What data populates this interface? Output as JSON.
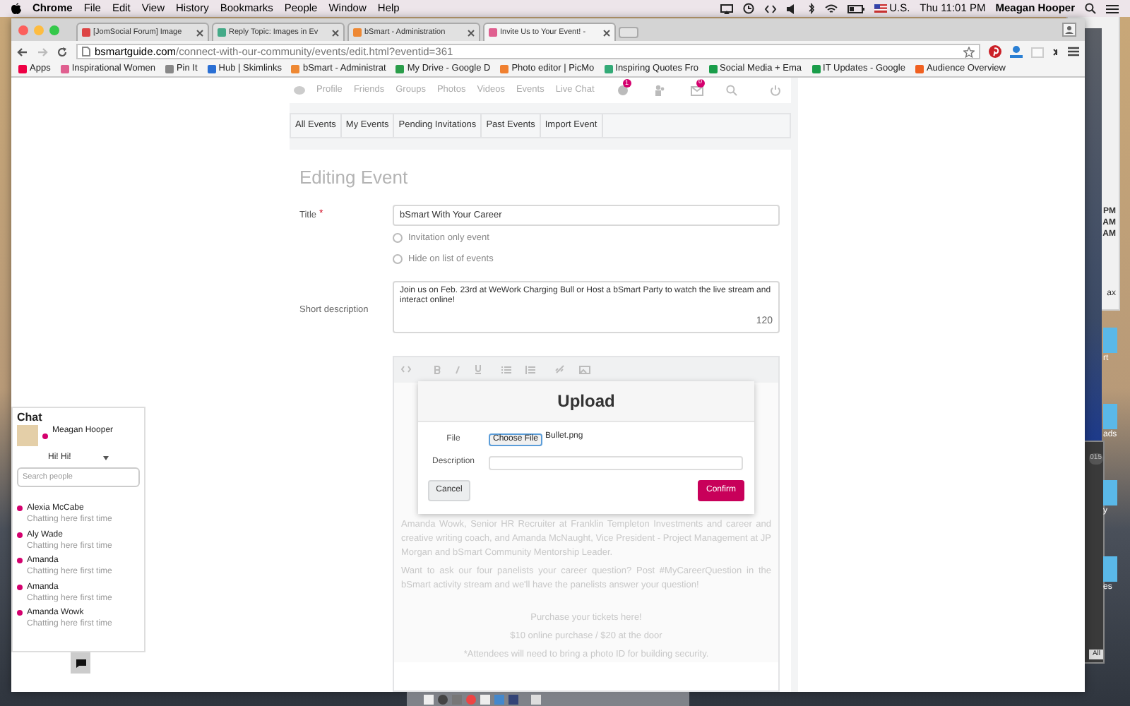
{
  "menu_bar": {
    "app": "Chrome",
    "menus": [
      "File",
      "Edit",
      "View",
      "History",
      "Bookmarks",
      "People",
      "Window",
      "Help"
    ],
    "input_source": "U.S.",
    "clock": "Thu 11:01 PM",
    "user": "Meagan Hooper"
  },
  "browser": {
    "tabs": [
      {
        "title": "[JomSocial Forum] Image",
        "selected": false
      },
      {
        "title": "Reply Topic: Images in Ev",
        "selected": false
      },
      {
        "title": "bSmart - Administration",
        "selected": false
      },
      {
        "title": "Invite Us to Your Event! -",
        "selected": true
      }
    ],
    "url_domain": "bsmartguide.com",
    "url_path": "/connect-with-our-community/events/edit.html?eventid=361",
    "bookmarks": [
      "Apps",
      "Inspirational Women",
      "Pin It",
      "Hub | Skimlinks",
      "bSmart - Administrat",
      "My Drive - Google D",
      "Photo editor | PicMo",
      "Inspiring Quotes Fro",
      "Social Media + Ema",
      "IT Updates - Google",
      "Audience Overview"
    ]
  },
  "site_nav": {
    "links": [
      "Profile",
      "Friends",
      "Groups",
      "Photos",
      "Videos",
      "Events",
      "Live Chat"
    ],
    "notification_badge": "1",
    "message_badge": "0"
  },
  "event_tabs": [
    "All Events",
    "My Events",
    "Pending Invitations",
    "Past Events",
    "Import Event"
  ],
  "form": {
    "heading": "Editing Event",
    "title_label": "Title",
    "required_mark": "*",
    "title_value": "bSmart With Your Career",
    "options": [
      {
        "label": "Invitation only event",
        "checked": false
      },
      {
        "label": "Hide on list of events",
        "checked": false
      }
    ],
    "description_label": "Short description",
    "description_value": "Join us on Feb. 23rd at WeWork Charging Bull or Host a bSmart Party to watch the live stream and interact online!",
    "char_count": "120"
  },
  "editor": {
    "paragraphs": [
      {
        "kind": "paragraph",
        "text": "Amanda Wowk, Senior HR Recruiter at Franklin Templeton Investments and career and creative writing coach, and Amanda McNaught, Vice President - Project Management at JP Morgan and bSmart Community Mentorship Leader."
      },
      {
        "kind": "paragraph",
        "text": "Want to ask our four panelists your career question? Post #MyCareerQuestion in the bSmart activity stream and we'll have the panelists answer your question!"
      },
      {
        "kind": "centered_line",
        "text": "Purchase your tickets here!"
      },
      {
        "kind": "centered_line",
        "text": "$10 online purchase / $20 at the door"
      },
      {
        "kind": "centered_line",
        "text": "*Attendees will need to bring a photo ID for building security."
      }
    ]
  },
  "upload_dialog": {
    "title": "Upload",
    "file_label": "File",
    "choose_button": "Choose File",
    "file_name": "Bullet.png",
    "description_label": "Description",
    "cancel": "Cancel",
    "confirm": "Confirm"
  },
  "chat": {
    "title": "Chat",
    "user": {
      "name": "Meagan Hooper",
      "color": "#d4006e"
    },
    "status": "Hi! Hi!",
    "search_placeholder": "Search people",
    "contacts": [
      {
        "name": "Alexia McCabe",
        "note": "Chatting here first time",
        "color": "#d4006e"
      },
      {
        "name": "Aly Wade",
        "note": "Chatting here first time",
        "color": "#d4006e"
      },
      {
        "name": "Amanda",
        "note": "Chatting here first time",
        "color": "#d4006e"
      },
      {
        "name": "Amanda",
        "note": "Chatting here first time",
        "color": "#d4006e"
      },
      {
        "name": "Amanda Wowk",
        "note": "Chatting here first time",
        "color": "#d4006e"
      }
    ]
  },
  "desktop": {
    "times": [
      "PM",
      "AM",
      "AM"
    ],
    "window_text": "ax",
    "folders": [
      "rt",
      "ads",
      "y",
      "es"
    ],
    "date_badge": "015",
    "button": "All"
  }
}
